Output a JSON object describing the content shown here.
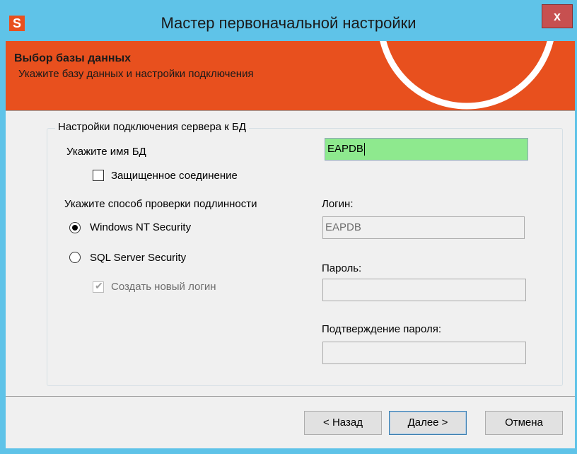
{
  "window": {
    "title": "Мастер первоначальной настройки",
    "app_icon_letter": "S",
    "close_glyph": "x",
    "accent_color": "#e8501e",
    "titlebar_color": "#5fc3e8"
  },
  "banner": {
    "title": "Выбор базы данных",
    "subtitle": "Укажите базу данных и настройки подключения"
  },
  "group": {
    "legend": "Настройки подключения сервера к БД",
    "db_name_label": "Укажите имя БД",
    "db_name_value": "EAPDB",
    "secure_connection_label": "Защищенное соединение",
    "secure_connection_checked": false,
    "auth_label": "Укажите способ проверки подлинности",
    "auth_options": [
      {
        "label": "Windows NT Security",
        "selected": true
      },
      {
        "label": "SQL Server Security",
        "selected": false
      }
    ],
    "create_login_label": "Создать новый логин",
    "create_login_checked": true,
    "login_label": "Логин:",
    "login_value": "EAPDB",
    "password_label": "Пароль:",
    "password_value": "",
    "confirm_label": "Подтверждение пароля:",
    "confirm_value": ""
  },
  "buttons": {
    "back": "< Назад",
    "next": "Далее >",
    "cancel": "Отмена"
  }
}
